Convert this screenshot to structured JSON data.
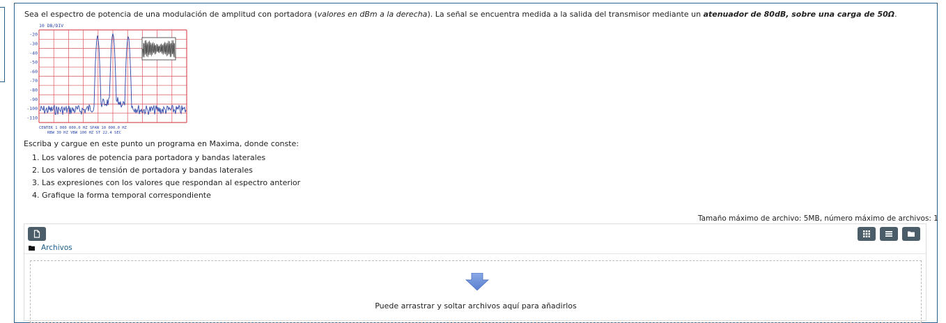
{
  "question": {
    "text_intro": "Sea el espectro de potencia de una modulación de amplitud con portadora (",
    "text_italic1": "valores en dBm a la derecha",
    "text_mid": "). La señal se encuentra medida a la salida del transmisor mediante un ",
    "text_bold_italic": "atenuador de  80dB, sobre una carga de 50Ω",
    "text_end": ".",
    "instruction": "Escriba y cargue en este punto un programa en Maxima, donde conste:",
    "steps": [
      "Los valores de potencia para portadora y bandas laterales",
      "Los valores de tensión de portadora y bandas laterales",
      "Las expresiones con los valores que respondan al espectro anterior",
      "Grafique la forma temporal correspondiente"
    ]
  },
  "spectrum_image": {
    "scale_label": "10 DB/DIV",
    "y_labels": [
      "-20",
      "-30",
      "-40",
      "-50",
      "-60",
      "-70",
      "-80",
      "-90",
      "-100",
      "-110"
    ],
    "footer_line1": "CENTER 1 000 000.0 HZ          SPAN 10 000.0 HZ",
    "footer_line2": "RBW 30 HZ    VBW 100 HZ      ST 22.4 SEC",
    "colors": {
      "grid": "#d9535a",
      "trace": "#2b45a8"
    }
  },
  "filemanager": {
    "limits": "Tamaño máximo de archivo: 5MB, número máximo de archivos: 1",
    "folder_label": "Archivos",
    "drop_text": "Puede arrastrar y soltar archivos aquí para añadirlos",
    "icons": {
      "add": "file-icon",
      "grid": "grid-icon",
      "list": "list-icon",
      "tree": "folder-icon",
      "path": "folder-icon",
      "drop": "arrow-down-icon"
    },
    "colors": {
      "button_bg": "#4b5d68",
      "link": "#1a5d8a",
      "arrow": "#6b8fd6"
    }
  }
}
